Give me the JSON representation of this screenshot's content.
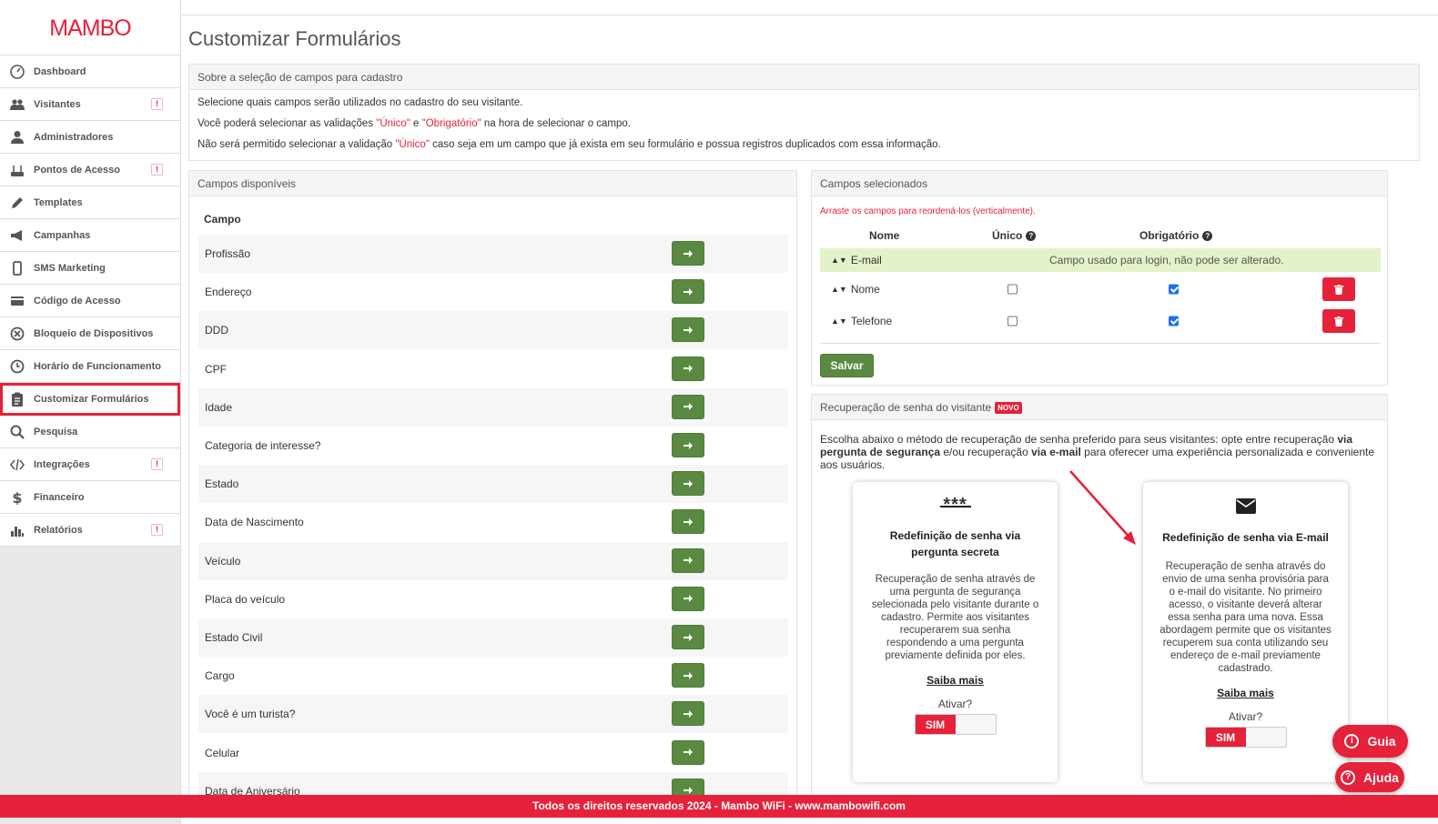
{
  "brand": {
    "logo_text": "MAMBO",
    "accent": "#e6213a",
    "green": "#5a8a42"
  },
  "sidebar": {
    "items": [
      {
        "label": "Dashboard",
        "icon": "dashboard-icon",
        "badge": ""
      },
      {
        "label": "Visitantes",
        "icon": "users-icon",
        "badge": "!"
      },
      {
        "label": "Administradores",
        "icon": "user-icon",
        "badge": ""
      },
      {
        "label": "Pontos de Acesso",
        "icon": "router-icon",
        "badge": "!"
      },
      {
        "label": "Templates",
        "icon": "pencil-icon",
        "badge": ""
      },
      {
        "label": "Campanhas",
        "icon": "megaphone-icon",
        "badge": ""
      },
      {
        "label": "SMS Marketing",
        "icon": "mobile-icon",
        "badge": ""
      },
      {
        "label": "Código de Acesso",
        "icon": "card-icon",
        "badge": ""
      },
      {
        "label": "Bloqueio de Dispositivos",
        "icon": "block-icon",
        "badge": ""
      },
      {
        "label": "Horário de Funcionamento",
        "icon": "clock-icon",
        "badge": ""
      },
      {
        "label": "Customizar Formulários",
        "icon": "clipboard-icon",
        "badge": "",
        "active": true
      },
      {
        "label": "Pesquisa",
        "icon": "search-icon",
        "badge": ""
      },
      {
        "label": "Integrações",
        "icon": "code-icon",
        "badge": "!"
      },
      {
        "label": "Financeiro",
        "icon": "dollar-icon",
        "badge": ""
      },
      {
        "label": "Relatórios",
        "icon": "chart-icon",
        "badge": "!"
      }
    ]
  },
  "page": {
    "title": "Customizar Formulários"
  },
  "info": {
    "heading": "Sobre a seleção de campos para cadastro",
    "line1": "Selecione quais campos serão utilizados no cadastro do seu visitante.",
    "line2_a": "Você poderá selecionar as validações ",
    "line2_unico": "\"Único\"",
    "line2_e": " e ",
    "line2_obrig": "\"Obrigatório\"",
    "line2_b": " na hora de selecionar o campo.",
    "line3_a": "Não será permitido selecionar a validação ",
    "line3_unico": "\"Único\"",
    "line3_b": " caso seja em um campo que já exista em seu formulário e possua registros duplicados com essa informação."
  },
  "available": {
    "heading": "Campos disponíveis",
    "column": "Campo",
    "fields": [
      "Profissão",
      "Endereço",
      "DDD",
      "CPF",
      "Idade",
      "Categoria de interesse?",
      "Estado",
      "Data de Nascimento",
      "Veículo",
      "Placa do veículo",
      "Estado Civil",
      "Cargo",
      "Você é um turista?",
      "Celular",
      "Data de Aniversário"
    ]
  },
  "selected": {
    "heading": "Campos selecionados",
    "hint": "Arraste os campos para reordená-los (verticalmente).",
    "col_nome": "Nome",
    "col_unico": "Único",
    "col_obrig": "Obrigatório",
    "login_field": "E-mail",
    "login_msg": "Campo usado para login, não pode ser alterado.",
    "rows": [
      {
        "name": "Nome",
        "unico": false,
        "obrigatorio": true
      },
      {
        "name": "Telefone",
        "unico": false,
        "obrigatorio": true
      }
    ],
    "save_label": "Salvar"
  },
  "recovery": {
    "heading": "Recuperação de senha do visitante",
    "badge": "NOVO",
    "desc_a": "Escolha abaixo o método de recuperação de senha preferido para seus visitantes: opte entre recuperação ",
    "desc_b1": "via pergunta de segurança",
    "desc_c": " e/ou recuperação ",
    "desc_b2": "via e-mail",
    "desc_d": " para oferecer uma experiência personalizada e conveniente aos usuários.",
    "cards": [
      {
        "icon_glyph": "***",
        "title": "Redefinição de senha via pergunta secreta",
        "text": "Recuperação de senha através de uma pergunta de segurança selecionada pelo visitante durante o cadastro. Permite aos visitantes recuperarem sua senha respondendo a uma pergunta previamente definida por eles.",
        "more": "Saiba mais",
        "activate": "Ativar?",
        "toggle": "SIM"
      },
      {
        "title": "Redefinição de senha via E-mail",
        "text": "Recuperação de senha através do envio de uma senha provisória para o e-mail do visitante. No primeiro acesso, o visitante deverá alterar essa senha para uma nova. Essa abordagem permite que os visitantes recuperem sua conta utilizando seu endereço de e-mail previamente cadastrado.",
        "more": "Saiba mais",
        "activate": "Ativar?",
        "toggle": "SIM"
      }
    ]
  },
  "footer": {
    "text": "Todos os direitos reservados 2024 - Mambo WiFi - www.mambowifi.com"
  },
  "fabs": {
    "guia": "Guia",
    "ajuda": "Ajuda"
  }
}
